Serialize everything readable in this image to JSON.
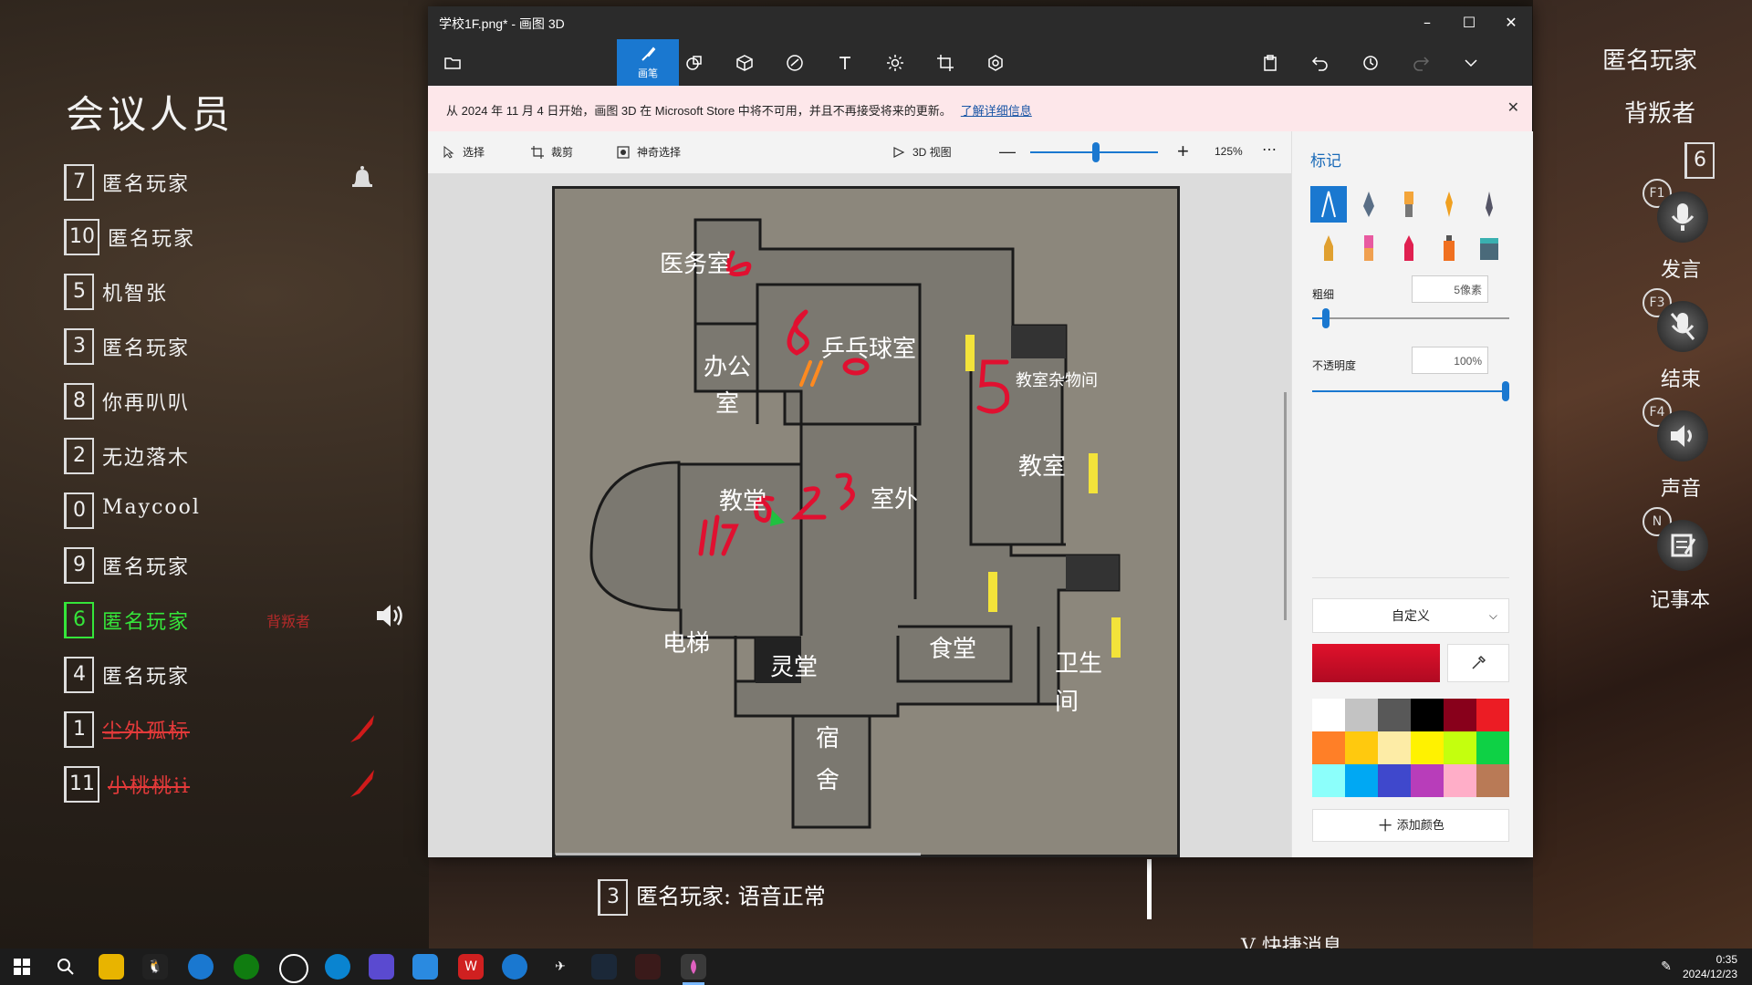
{
  "game": {
    "meeting_title": "会议人员",
    "members": [
      {
        "num": "7",
        "name": "匿名玩家"
      },
      {
        "num": "10",
        "name": "匿名玩家"
      },
      {
        "num": "5",
        "name": "机智张"
      },
      {
        "num": "3",
        "name": "匿名玩家"
      },
      {
        "num": "8",
        "name": "你再叭叭"
      },
      {
        "num": "2",
        "name": "无边落木"
      },
      {
        "num": "0",
        "name": "Maycool"
      },
      {
        "num": "9",
        "name": "匿名玩家"
      },
      {
        "num": "6",
        "name": "匿名玩家",
        "role": "背叛者"
      },
      {
        "num": "4",
        "name": "匿名玩家"
      },
      {
        "num": "1",
        "name": "尘外孤标"
      },
      {
        "num": "11",
        "name": "小桃桃ii"
      }
    ],
    "right_panel": {
      "player_name": "匿名玩家",
      "player_role": "背叛者",
      "player_num": "6",
      "speak": {
        "key": "F1",
        "label": "发言"
      },
      "end": {
        "key": "F3",
        "label": "结束"
      },
      "sound": {
        "key": "F4",
        "label": "声音"
      },
      "notebook": {
        "key": "N",
        "label": "记事本"
      }
    },
    "chat": {
      "num": "3",
      "text": "匿名玩家: 语音正常"
    },
    "quick_message": "V  快捷消息"
  },
  "paint3d": {
    "title": "学校1F.png* - 画图 3D",
    "active_tool_label": "画笔",
    "notice": "从 2024 年 11 月 4 日开始，画图 3D 在 Microsoft Store 中将不可用，并且不再接受将来的更新。",
    "notice_link": "了解详细信息",
    "subtoolbar": {
      "select": "选择",
      "crop": "裁剪",
      "magic_select": "神奇选择",
      "view_3d": "3D 视图",
      "zoom": "125%"
    },
    "map_labels": {
      "infirmary": "医务室",
      "office": "办公室",
      "ping_pong": "乒乓球室",
      "storage": "教室杂物间",
      "classroom_left": "教堂",
      "outdoor": "室外",
      "classroom_right": "教室",
      "elevator": "电梯",
      "hall": "灵堂",
      "canteen": "食堂",
      "toilet": "卫生间",
      "dorm": "宿舍"
    },
    "panel": {
      "title": "标记",
      "thickness_label": "粗细",
      "thickness_value": "5像素",
      "thickness_fraction": 0.05,
      "opacity_label": "不透明度",
      "opacity_value": "100%",
      "opacity_fraction": 1.0,
      "dropdown": "自定义",
      "current_color": "#e0112b",
      "add_color": "添加颜色",
      "palette": [
        "#ffffff",
        "#c3c3c3",
        "#585858",
        "#000000",
        "#88001b",
        "#ec1c24",
        "#ff7f27",
        "#ffc90e",
        "#fdeca6",
        "#fff200",
        "#c4ff0e",
        "#0ed145",
        "#8cfffb",
        "#00a8f3",
        "#3f48cc",
        "#b83dba",
        "#ffaec8",
        "#b97a56"
      ]
    }
  },
  "taskbar": {
    "time": "0:35",
    "date": "2024/12/23"
  }
}
